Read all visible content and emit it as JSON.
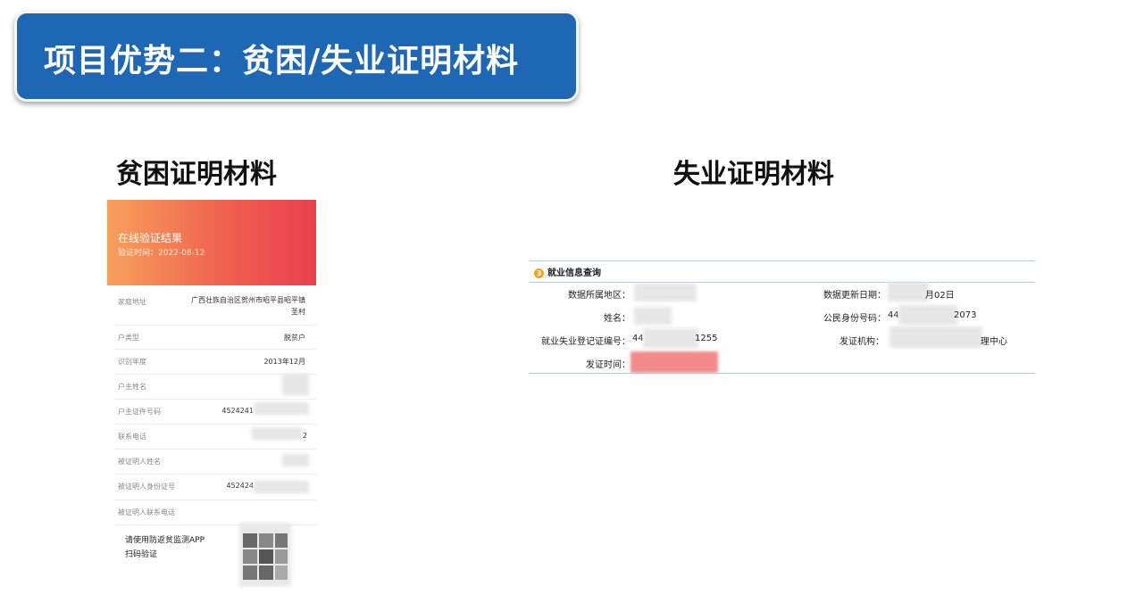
{
  "banner": {
    "title": "项目优势二：贫困/失业证明材料"
  },
  "left_section": {
    "title": "贫困证明材料"
  },
  "right_section": {
    "title": "失业证明材料"
  },
  "poverty_card": {
    "header_title": "在线验证结果",
    "header_sub": "验证时间：2022-08-12",
    "rows": [
      {
        "label": "家庭地址",
        "value_line1": "广西壮族自治区贺州市昭平县昭平镇",
        "value_line2": "圣村"
      },
      {
        "label": "户类型",
        "value": "脱贫户"
      },
      {
        "label": "识别年度",
        "value": "2013年12月"
      },
      {
        "label": "户主姓名",
        "value": ""
      },
      {
        "label": "户主证件号码",
        "value": "4524241"
      },
      {
        "label": "联系电话",
        "value": "2"
      },
      {
        "label": "被证明人姓名",
        "value": ""
      },
      {
        "label": "被证明人身份证号",
        "value": "452424"
      },
      {
        "label": "被证明人联系电话",
        "value": ""
      }
    ],
    "qr_hint_line1": "请使用防返贫监测APP",
    "qr_hint_line2": "扫码验证"
  },
  "employment_panel": {
    "header": "就业信息查询",
    "icon_number": "3",
    "fields": {
      "region_label": "数据所属地区：",
      "name_label": "姓名：",
      "reg_no_label": "就业失业登记证编号：",
      "reg_no_value": "44",
      "reg_no_value_tail": "1255",
      "issue_time_label": "发证时间：",
      "update_date_label": "数据更新日期：",
      "update_date_value": "月02日",
      "id_label": "公民身份号码：",
      "id_value": "44",
      "id_value_tail": "2073",
      "agency_label": "发证机构：",
      "agency_value": "理中心"
    }
  }
}
